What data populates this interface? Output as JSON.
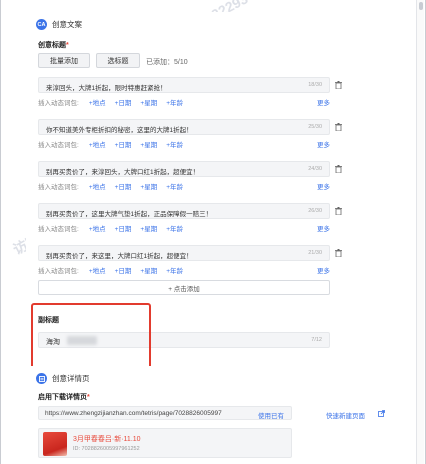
{
  "section_creative": {
    "icon": "CA",
    "title": "创意文案"
  },
  "creative_title": {
    "label": "创意标题",
    "required_mark": "*",
    "batch_add_label": "批量添加",
    "pick_title_label": "选标题",
    "added_count": "已添加：5/10",
    "items": [
      {
        "text": "来淳回头，大牌1折起，限时特惠赶紧抢！",
        "count": "18/30"
      },
      {
        "text": "你不知道美外专柜折扣的秘密，这里的大牌1折起！",
        "count": "25/30"
      },
      {
        "text": "别再买贵价了，来淳回头，大牌口红1折起，超便宜！",
        "count": "24/30"
      },
      {
        "text": "别再买贵价了，这里大牌气垫1折起，正品保障假一赔三！",
        "count": "26/30"
      },
      {
        "text": "别再买贵价了，来这里，大牌口红1折起，超便宜！",
        "count": "21/30"
      }
    ],
    "insert_label": "插入动态词包:",
    "insert_options": [
      "+地点",
      "+日期",
      "+星期",
      "+年龄"
    ],
    "more_label": "更多",
    "add_item_label": "+ 点击添加"
  },
  "subtitle": {
    "label": "副标题",
    "value": "海淘",
    "count": "7/12"
  },
  "section_detail": {
    "title": "创意详情页"
  },
  "landing": {
    "label": "启用下载详情页",
    "required_mark": "*",
    "url": "https://www.zhengzijianzhan.com/tetris/page/7028826005997",
    "use_existing_label": "使用已有",
    "quick_new_label": "快速新建页面",
    "preview_title": "3月甲春春吕·新·11.10",
    "preview_id": "ID: 7028826005997961252"
  },
  "watermark": "访客 22293",
  "colors": {
    "accent": "#3b73e8",
    "highlight": "#e23b2e",
    "required": "#e84a3c"
  }
}
